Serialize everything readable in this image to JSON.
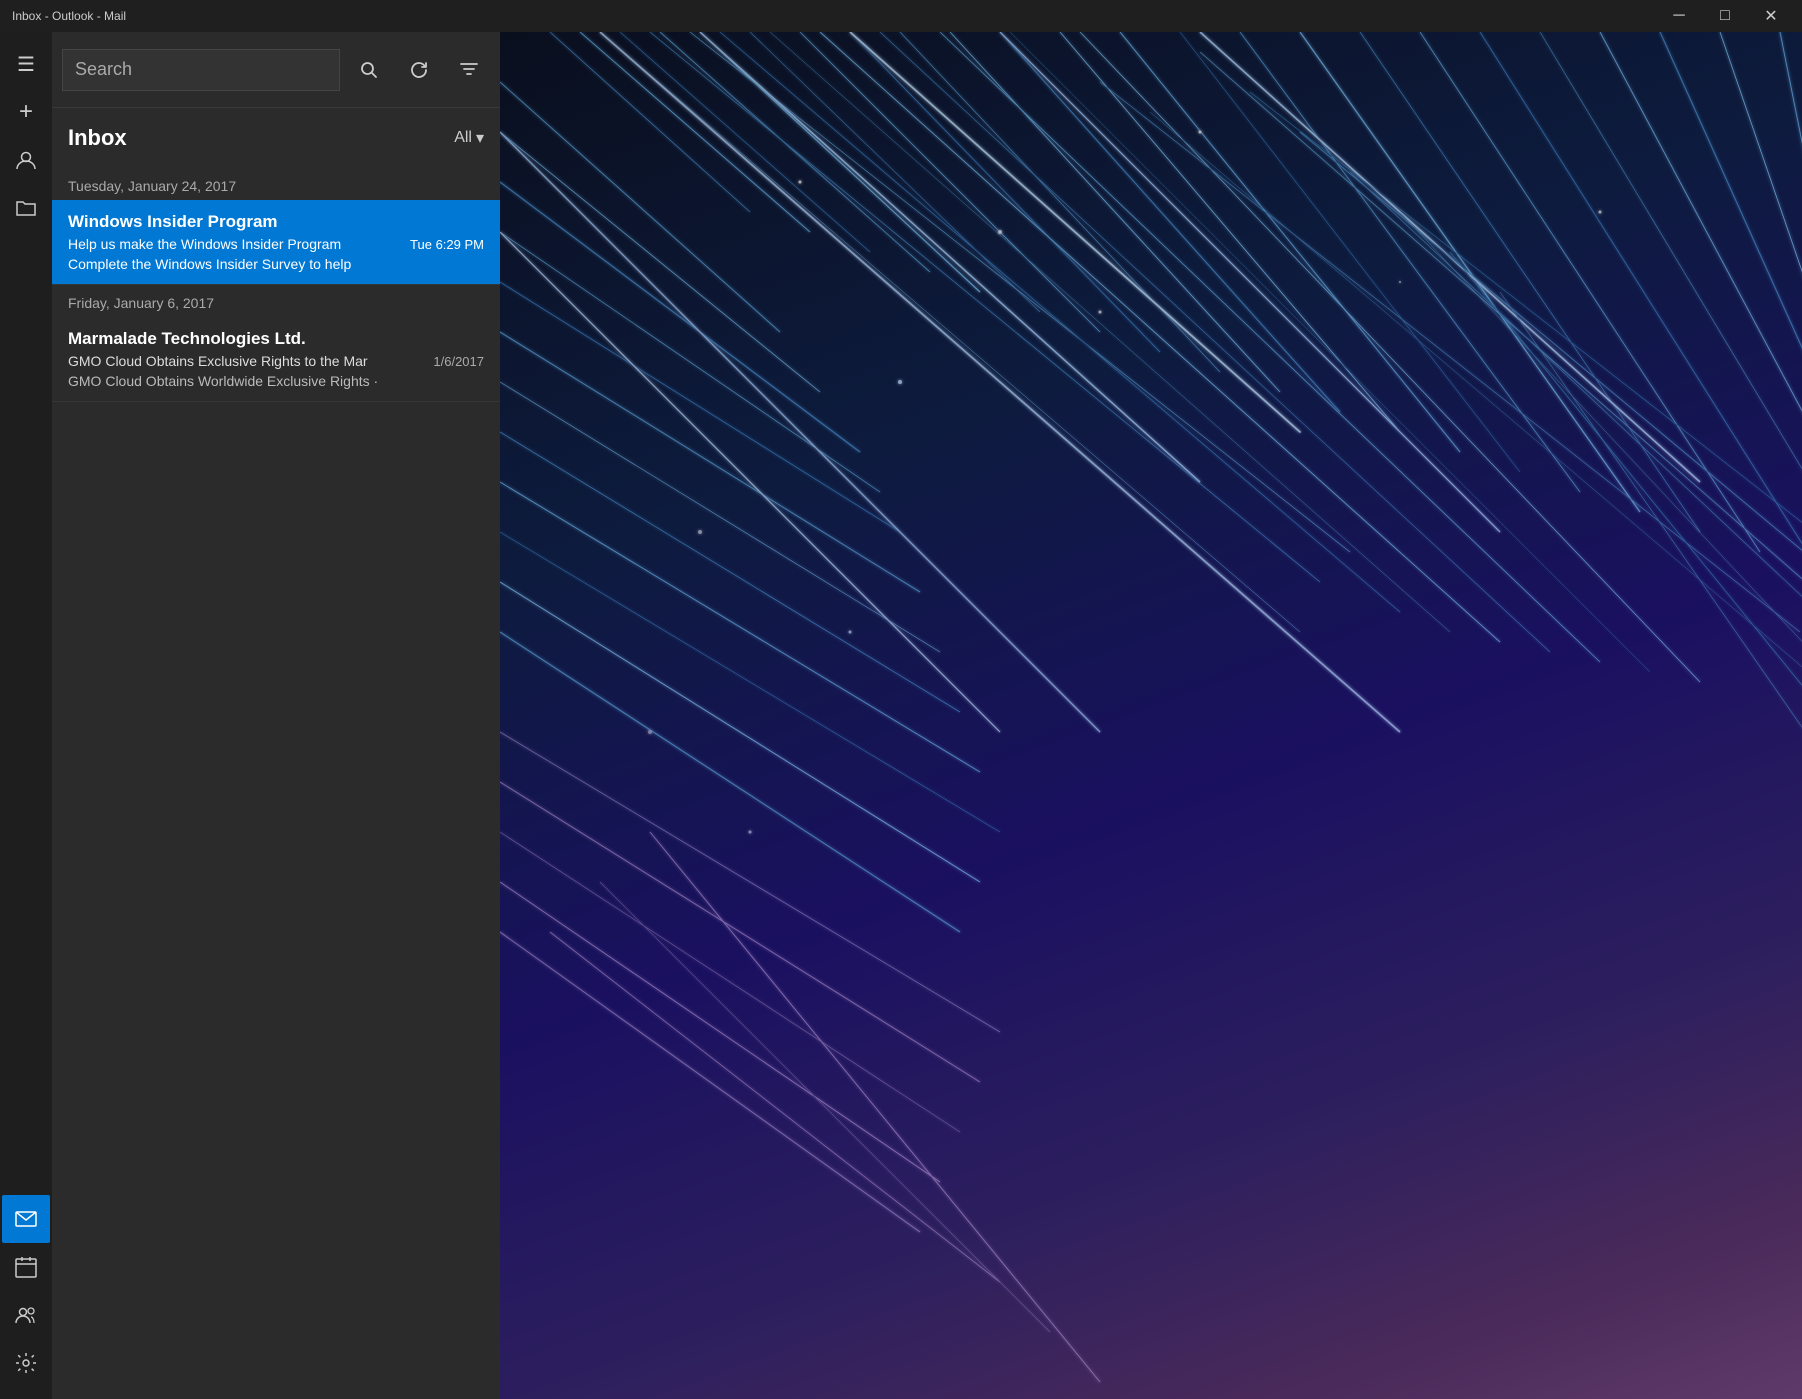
{
  "window": {
    "title": "Inbox - Outlook - Mail",
    "controls": {
      "minimize": "─",
      "maximize": "□",
      "close": "✕"
    }
  },
  "nav": {
    "icons": [
      {
        "name": "hamburger-icon",
        "symbol": "☰",
        "interactable": true,
        "active": false
      },
      {
        "name": "compose-icon",
        "symbol": "+",
        "interactable": true,
        "active": false
      },
      {
        "name": "account-icon",
        "symbol": "👤",
        "interactable": true,
        "active": false
      },
      {
        "name": "folder-icon",
        "symbol": "🗂",
        "interactable": true,
        "active": false
      }
    ],
    "bottom_icons": [
      {
        "name": "mail-icon",
        "symbol": "✉",
        "interactable": true,
        "active": true
      },
      {
        "name": "calendar-icon",
        "symbol": "📅",
        "interactable": true,
        "active": false
      },
      {
        "name": "people-icon",
        "symbol": "👥",
        "interactable": true,
        "active": false
      },
      {
        "name": "settings-icon",
        "symbol": "⚙",
        "interactable": true,
        "active": false
      }
    ]
  },
  "search": {
    "placeholder": "Search",
    "value": ""
  },
  "toolbar": {
    "sync_label": "⟳",
    "filter_label": "≡"
  },
  "inbox": {
    "title": "Inbox",
    "filter_label": "All",
    "filter_arrow": "▾"
  },
  "emails": [
    {
      "date_group": "Tuesday, January 24, 2017",
      "items": [
        {
          "sender": "Windows Insider Program",
          "subject": "Help us make the Windows Insider Program",
          "time": "Tue 6:29 PM",
          "preview": "Complete the Windows Insider Survey to help",
          "selected": true
        }
      ]
    },
    {
      "date_group": "Friday, January 6, 2017",
      "items": [
        {
          "sender": "Marmalade Technologies Ltd.",
          "subject": "GMO Cloud Obtains Exclusive Rights to the Mar",
          "time": "1/6/2017",
          "preview": "GMO Cloud Obtains Worldwide Exclusive Rights ·",
          "selected": false
        }
      ]
    }
  ]
}
